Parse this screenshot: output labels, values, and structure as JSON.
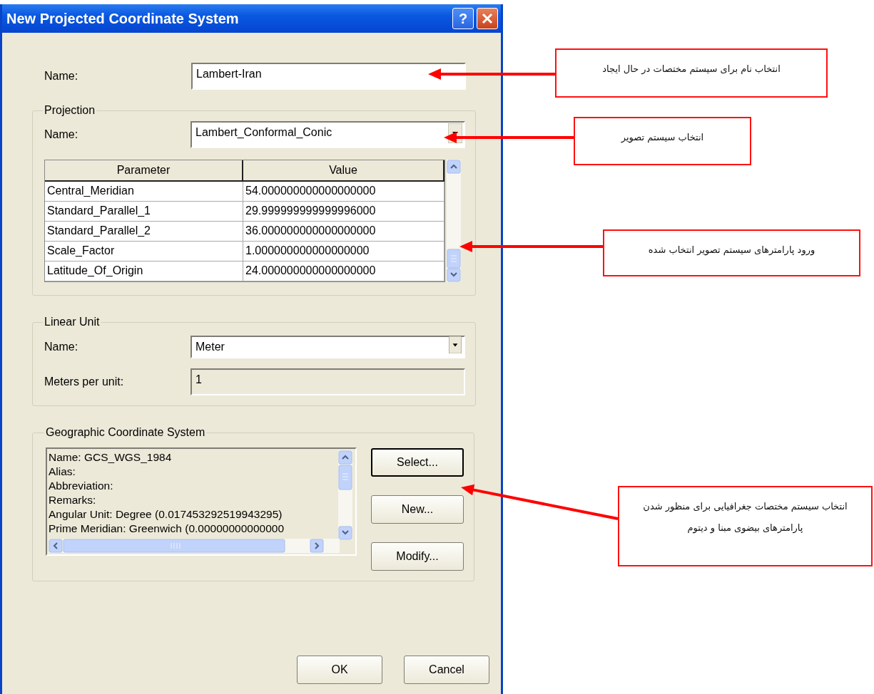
{
  "window": {
    "title": "New Projected Coordinate System",
    "help_button": "?"
  },
  "name_field": {
    "label": "Name:",
    "value": "Lambert-Iran"
  },
  "projection": {
    "title": "Projection",
    "name_label": "Name:",
    "name_value": "Lambert_Conformal_Conic",
    "table": {
      "columns": [
        "Parameter",
        "Value"
      ],
      "rows": [
        {
          "parameter": "Central_Meridian",
          "value": "54.000000000000000000"
        },
        {
          "parameter": "Standard_Parallel_1",
          "value": "29.999999999999996000"
        },
        {
          "parameter": "Standard_Parallel_2",
          "value": "36.000000000000000000"
        },
        {
          "parameter": "Scale_Factor",
          "value": "1.000000000000000000"
        },
        {
          "parameter": "Latitude_Of_Origin",
          "value": "24.000000000000000000"
        }
      ]
    }
  },
  "linear_unit": {
    "title": "Linear Unit",
    "name_label": "Name:",
    "name_value": "Meter",
    "meters_label": "Meters per unit:",
    "meters_value": "1"
  },
  "geographic": {
    "title": "Geographic Coordinate System",
    "lines": [
      "Name: GCS_WGS_1984",
      "Alias:",
      "Abbreviation:",
      "Remarks:",
      "Angular Unit: Degree (0.017453292519943295)",
      "Prime Meridian: Greenwich (0.00000000000000"
    ],
    "buttons": [
      {
        "label": "Select...",
        "focused": true
      },
      {
        "label": "New...",
        "focused": false
      },
      {
        "label": "Modify...",
        "focused": false
      }
    ]
  },
  "buttons": [
    "OK",
    "Cancel"
  ],
  "annotations": [
    {
      "text": "انتخاب نام برای سیستم مختصات در حال ایجاد"
    },
    {
      "text": "انتخاب سیستم تصویر"
    },
    {
      "text": "ورود پارامترهای سیستم تصویر انتخاب شده"
    },
    {
      "text": "انتخاب سیستم مختصات جغرافیایی برای منظور شدن پارامترهای بیضوی مبنا و دیتوم"
    }
  ]
}
